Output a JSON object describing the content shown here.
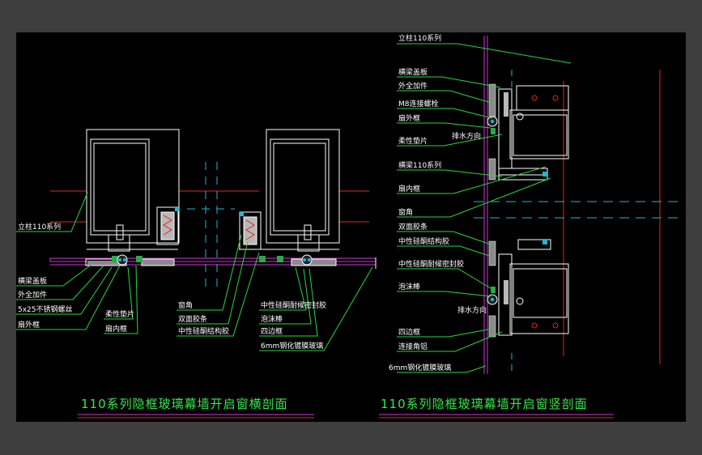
{
  "left": {
    "title": "110系列隐框玻璃幕墙开启窗横剖面",
    "labels": {
      "mullion": "立柱110系列",
      "cover": "横梁盖板",
      "outer_part": "外全加件",
      "screw": "5x25不锈钢螺丝",
      "sash_outer": "扇外框",
      "pad": "柔性垫片",
      "sash_inner": "扇内框",
      "window_corner": "窗角",
      "glue_strip": "双面胶条",
      "struct_sealant": "中性硅酮结构胶",
      "weather_sealant": "中性硅酮耐候密封胶",
      "foam_rod": "泡沫棒",
      "four_side_frame": "四边框",
      "glass": "6mm钢化镀膜玻璃"
    }
  },
  "right": {
    "title": "110系列隐框玻璃幕墙开启窗竖剖面",
    "labels": {
      "mullion": "立柱110系列",
      "cover": "横梁盖板",
      "outer_part": "外全加件",
      "bolt": "M8连接螺栓",
      "sash_outer": "扇外框",
      "pad": "柔性垫片",
      "drain_1": "排水方向",
      "transom": "横梁110系列",
      "sash_inner": "扇内框",
      "window_corner": "窗角",
      "glue_strip": "双面胶条",
      "struct_sealant": "中性硅酮结构胶",
      "weather_sealant": "中性硅酮耐候密封胶",
      "foam_rod": "泡沫棒",
      "drain_2": "排水方向",
      "four_side_frame": "四边框",
      "corner_alu": "连接角铝",
      "glass": "6mm钢化镀膜玻璃"
    }
  },
  "colors": {
    "background": "#000000",
    "frame": "#3e3e3e",
    "profile": "#ffffff",
    "leader": "#28d83a",
    "axis": "#1fb7d6",
    "glass": "#cc3ad0",
    "red_line": "#e02424",
    "title": "#35e84a"
  }
}
